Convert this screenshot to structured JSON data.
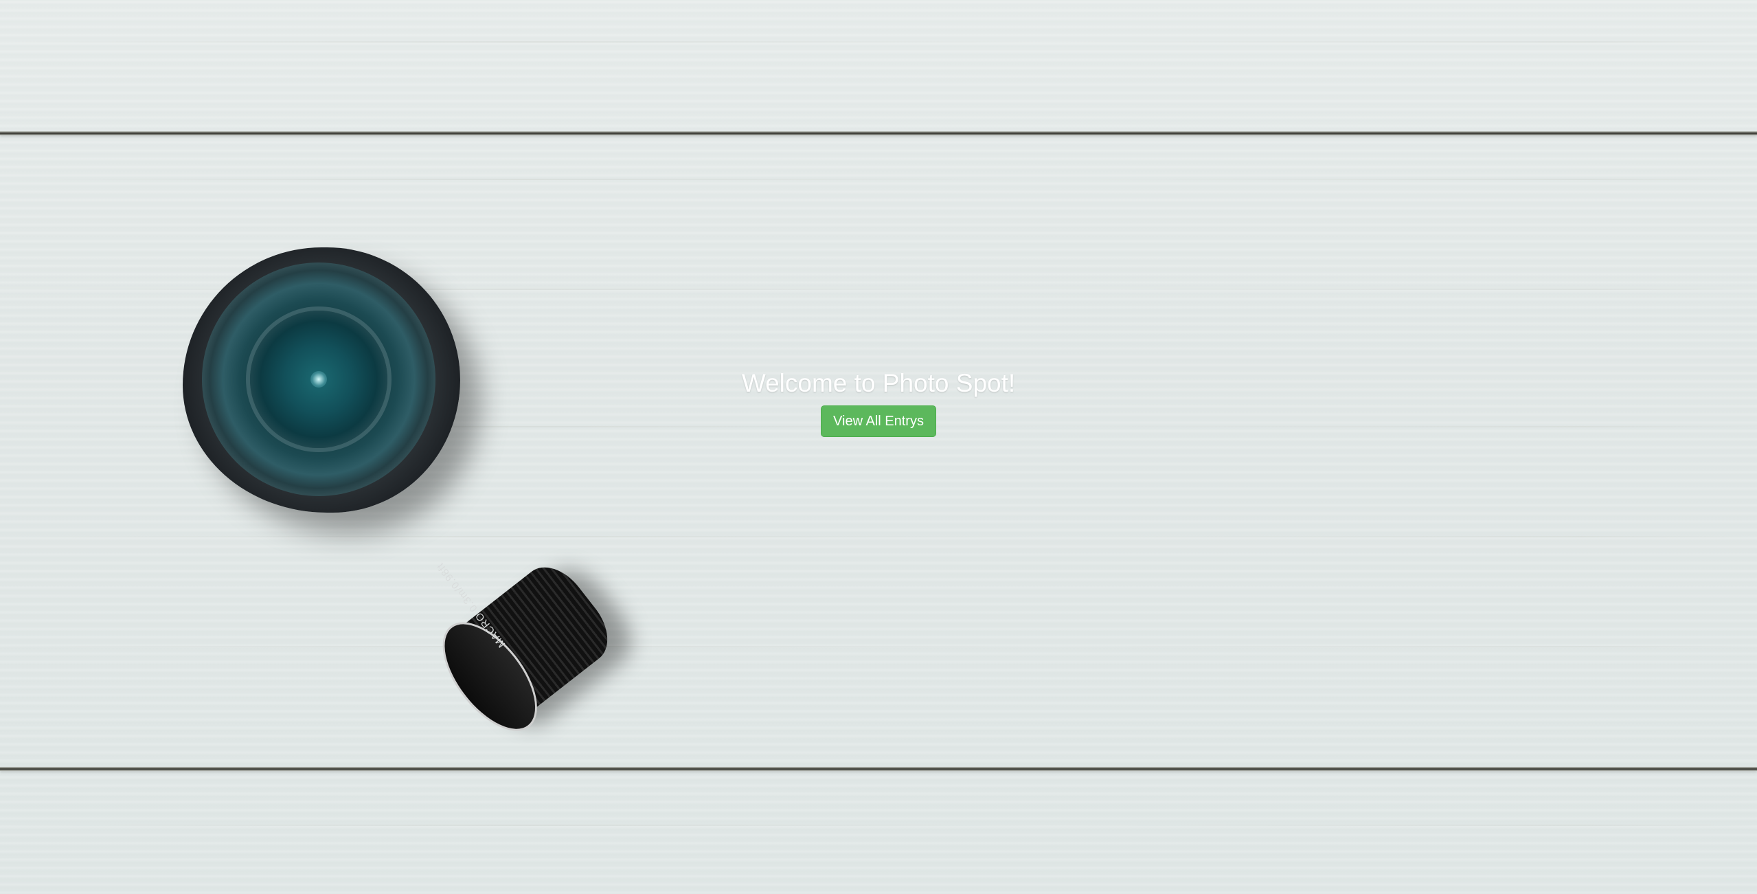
{
  "hero": {
    "title": "Welcome to Photo Spot!",
    "cta_label": "View All Entrys"
  },
  "background": {
    "lens_marking": "MACRO 0.3m/0.98ft"
  },
  "colors": {
    "cta_background": "#5cb85c",
    "cta_border": "#4cae4c",
    "title_text": "#ffffff",
    "wood_background": "#e3e9e8"
  },
  "icons": [
    "camera-lens-image",
    "pancake-lens-image"
  ]
}
